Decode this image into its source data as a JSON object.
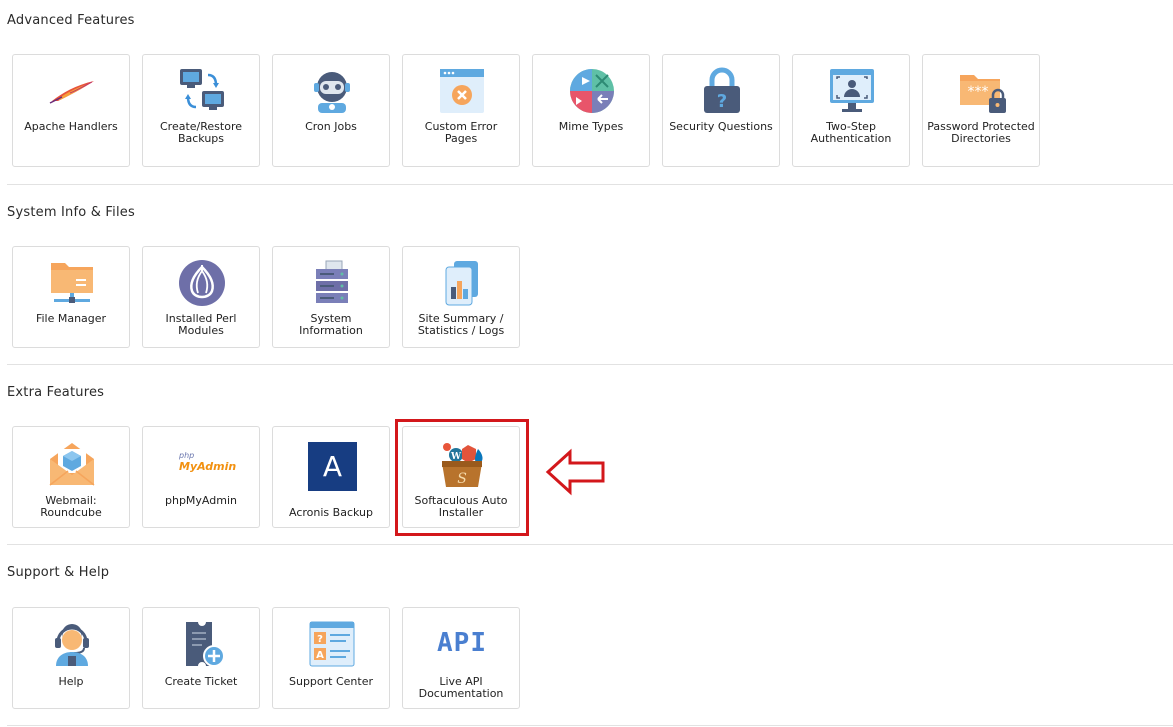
{
  "sections": [
    {
      "title": "Advanced Features",
      "items": [
        {
          "label": "Apache Handlers",
          "icon": "feather-icon"
        },
        {
          "label": "Create/Restore Backups",
          "icon": "backup-computers-icon"
        },
        {
          "label": "Cron Jobs",
          "icon": "robot-icon"
        },
        {
          "label": "Custom Error Pages",
          "icon": "error-page-icon"
        },
        {
          "label": "Mime Types",
          "icon": "media-types-icon"
        },
        {
          "label": "Security Questions",
          "icon": "lock-question-icon"
        },
        {
          "label": "Two-Step Authentication",
          "icon": "monitor-user-icon"
        },
        {
          "label": "Password Protected Directories",
          "icon": "locked-folder-icon"
        }
      ]
    },
    {
      "title": "System Info & Files",
      "items": [
        {
          "label": "File Manager",
          "icon": "folder-network-icon"
        },
        {
          "label": "Installed Perl Modules",
          "icon": "onion-icon"
        },
        {
          "label": "System Information",
          "icon": "server-icon"
        },
        {
          "label": "Site Summary / Statistics / Logs",
          "icon": "statistics-icon"
        }
      ]
    },
    {
      "title": "Extra Features",
      "items": [
        {
          "label": "Webmail: Roundcube",
          "icon": "mail-envelope-icon"
        },
        {
          "label": "phpMyAdmin",
          "icon": "phpmyadmin-logo-icon",
          "logo_top": "php",
          "logo_bottom": "MyAdmin"
        },
        {
          "label": "Acronis Backup",
          "icon": "acronis-logo-icon",
          "logo_letter": "A"
        },
        {
          "label": "Softaculous Auto Installer",
          "icon": "softaculous-box-icon"
        }
      ]
    },
    {
      "title": "Support & Help",
      "items": [
        {
          "label": "Help",
          "icon": "headset-agent-icon"
        },
        {
          "label": "Create Ticket",
          "icon": "ticket-plus-icon"
        },
        {
          "label": "Support Center",
          "icon": "qa-document-icon"
        },
        {
          "label": "Live API Documentation",
          "icon": "api-icon",
          "icon_text": "API"
        }
      ]
    }
  ],
  "annotation": {
    "highlight_color": "#d3171b",
    "arrow_icon": "left-arrow-icon"
  }
}
